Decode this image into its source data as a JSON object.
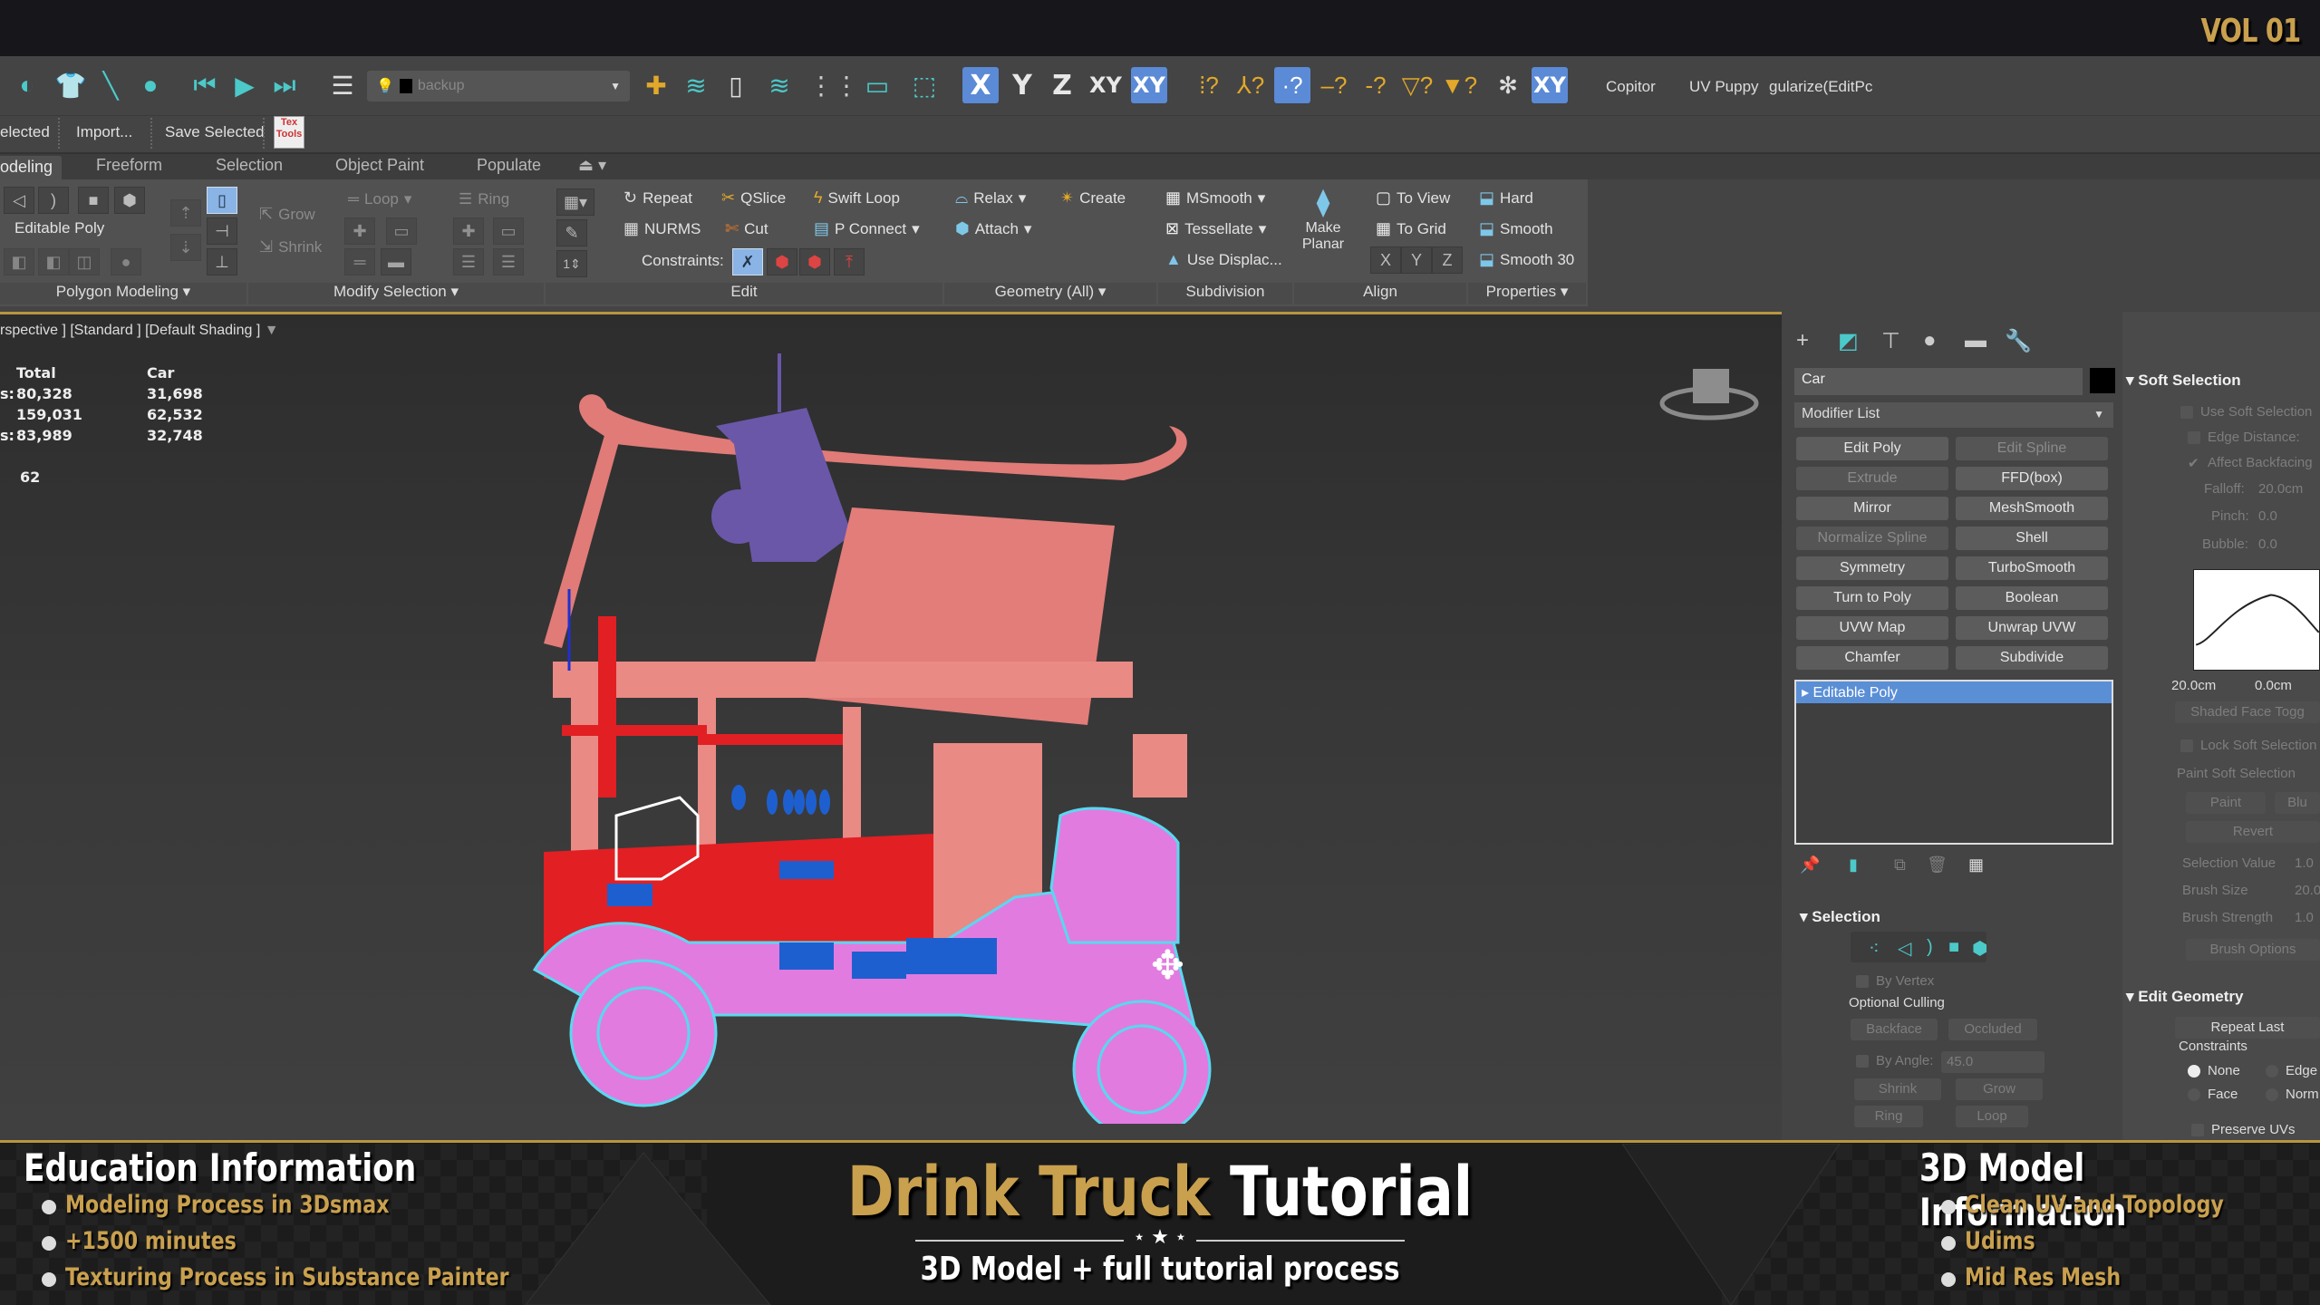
{
  "overlay": {
    "volume": "VOL 01"
  },
  "toolbar": {
    "layer_dropdown": "backup",
    "axis_buttons": [
      "X",
      "Y",
      "Z",
      "XY",
      "XY"
    ],
    "plugins": [
      "Copitor",
      "UV Puppy",
      "gularize(EditPc"
    ]
  },
  "toolbar2": {
    "items": [
      "elected",
      "Import...",
      "Save Selected"
    ],
    "textools": "Tex Tools"
  },
  "ribbon_tabs": [
    "odeling",
    "Freeform",
    "Selection",
    "Object Paint",
    "Populate"
  ],
  "ribbon": {
    "polygon_modeling": {
      "label": "Polygon Modeling",
      "editable_poly": "Editable Poly"
    },
    "modify_selection": {
      "label": "Modify Selection",
      "grow": "Grow",
      "shrink": "Shrink",
      "loop": "Loop",
      "ring": "Ring"
    },
    "edit": {
      "label": "Edit",
      "repeat": "Repeat",
      "qslice": "QSlice",
      "swift_loop": "Swift Loop",
      "nurms": "NURMS",
      "cut": "Cut",
      "p_connect": "P Connect",
      "constraints": "Constraints:",
      "spinner": "1"
    },
    "geometry": {
      "label": "Geometry (All)",
      "relax": "Relax",
      "create": "Create",
      "attach": "Attach"
    },
    "subdivision": {
      "label": "Subdivision",
      "msmooth": "MSmooth",
      "tessellate": "Tessellate",
      "use_displace": "Use Displac..."
    },
    "align": {
      "label": "Align",
      "make_planar": "Make Planar",
      "to_view": "To View",
      "to_grid": "To Grid",
      "x": "X",
      "y": "Y",
      "z": "Z"
    },
    "properties": {
      "label": "Properties",
      "hard": "Hard",
      "smooth": "Smooth",
      "smooth30": "Smooth 30"
    }
  },
  "viewport": {
    "label": "rspective ] [Standard ] [Default Shading ]",
    "stats": {
      "headers": [
        "Total",
        "Car"
      ],
      "rows": [
        {
          "key": "s:",
          "total": "80,328",
          "car": "31,698"
        },
        {
          "key": "",
          "total": "159,031",
          "car": "62,532"
        },
        {
          "key": "s:",
          "total": "83,989",
          "car": "32,748"
        }
      ],
      "fps": "62"
    }
  },
  "command_panel": {
    "object_name": "Car",
    "modifier_list": "Modifier List",
    "modifiers": [
      {
        "label": "Edit Poly",
        "enabled": true
      },
      {
        "label": "Edit Spline",
        "enabled": false
      },
      {
        "label": "Extrude",
        "enabled": false
      },
      {
        "label": "FFD(box)",
        "enabled": true
      },
      {
        "label": "Mirror",
        "enabled": true
      },
      {
        "label": "MeshSmooth",
        "enabled": true
      },
      {
        "label": "Normalize Spline",
        "enabled": false
      },
      {
        "label": "Shell",
        "enabled": true
      },
      {
        "label": "Symmetry",
        "enabled": true
      },
      {
        "label": "TurboSmooth",
        "enabled": true
      },
      {
        "label": "Turn to Poly",
        "enabled": true
      },
      {
        "label": "Boolean",
        "enabled": true
      },
      {
        "label": "UVW Map",
        "enabled": true
      },
      {
        "label": "Unwrap UVW",
        "enabled": true
      },
      {
        "label": "Chamfer",
        "enabled": true
      },
      {
        "label": "Subdivide",
        "enabled": true
      }
    ],
    "stack_item": "Editable Poly",
    "selection": {
      "title": "Selection",
      "by_vertex": "By Vertex",
      "optional_culling": "Optional Culling",
      "backface": "Backface",
      "occluded": "Occluded",
      "by_angle": "By Angle:",
      "angle": "45.0",
      "shrink": "Shrink",
      "grow": "Grow",
      "ring": "Ring",
      "loop": "Loop"
    },
    "soft_selection": {
      "title": "Soft Selection",
      "use_soft": "Use Soft Selection",
      "edge_distance": "Edge Distance:",
      "affect_backfacing": "Affect Backfacing",
      "falloff_label": "Falloff:",
      "falloff": "20.0cm",
      "pinch_label": "Pinch:",
      "pinch": "0.0",
      "bubble_label": "Bubble:",
      "bubble": "0.0",
      "curve_left": "20.0cm",
      "curve_mid": "0.0cm",
      "shaded_face": "Shaded Face Togg",
      "lock": "Lock Soft Selection",
      "paint_group": "Paint Soft Selection",
      "paint": "Paint",
      "blur": "Blu",
      "revert": "Revert",
      "sel_value_label": "Selection Value",
      "sel_value": "1.0",
      "brush_size_label": "Brush Size",
      "brush_size": "20.0",
      "brush_strength_label": "Brush Strength",
      "brush_strength": "1.0",
      "brush_options": "Brush Options"
    },
    "edit_geometry": {
      "title": "Edit Geometry",
      "repeat_last": "Repeat Last",
      "constraints": "Constraints",
      "none": "None",
      "edge": "Edge",
      "face": "Face",
      "normal": "Norm",
      "preserve_uvs": "Preserve UVs"
    }
  },
  "banner": {
    "left_title": "Education Information",
    "left_items": [
      "Modeling Process in 3Dsmax",
      "+1500 minutes",
      "Texturing Process in Substance Painter"
    ],
    "title_gold": "Drink Truck",
    "title_white": "Tutorial",
    "subtitle": "3D Model + full tutorial process",
    "right_title": "3D Model Information",
    "right_items": [
      "Clean UV and Topology",
      "Udims",
      "Mid Res Mesh"
    ]
  },
  "colors": {
    "accent_gold": "#c9a04e",
    "selection_blue": "#5b8ad6",
    "highlight_cyan": "#4cc9c9"
  }
}
